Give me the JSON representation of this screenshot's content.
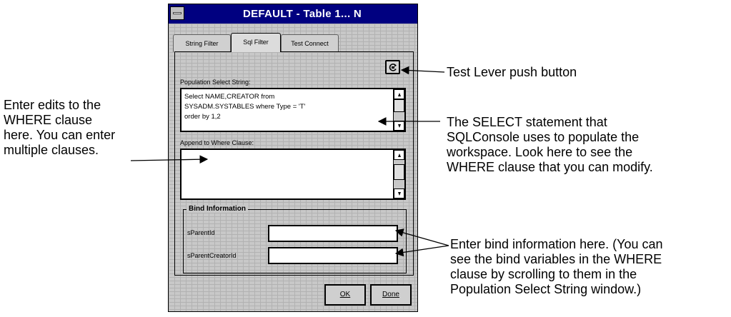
{
  "window": {
    "title": "DEFAULT - Table 1... N"
  },
  "tabs": [
    {
      "label": "String Filter",
      "active": false
    },
    {
      "label": "Sql Filter",
      "active": true
    },
    {
      "label": "Test Connect",
      "active": false
    }
  ],
  "sql_filter": {
    "population_label": "Population Select String:",
    "population_lines": [
      "Select NAME,CREATOR from",
      "SYSADM.SYSTABLES where Type = 'T'",
      "order by 1,2"
    ],
    "append_label": "Append to Where Clause:",
    "append_value": "",
    "test_lever_icon": "lever-icon"
  },
  "bind_information": {
    "title": "Bind Information",
    "fields": [
      {
        "label": "sParentId",
        "value": ""
      },
      {
        "label": "sParentCreatorId",
        "value": ""
      }
    ]
  },
  "buttons": {
    "ok": "OK",
    "done": "Done"
  },
  "annotations": {
    "test_lever": "Test Lever push button",
    "select_statement": [
      "The SELECT statement that",
      "SQLConsole uses to populate the",
      "workspace. Look here to see the",
      "WHERE clause that you can modify."
    ],
    "where_clause": [
      "Enter edits to the",
      "WHERE clause",
      "here. You can enter",
      "multiple clauses."
    ],
    "bind_info": [
      "Enter bind information here. (You can",
      "see the bind variables in the WHERE",
      "clause by scrolling to them in the",
      "Population Select String window.)"
    ]
  }
}
